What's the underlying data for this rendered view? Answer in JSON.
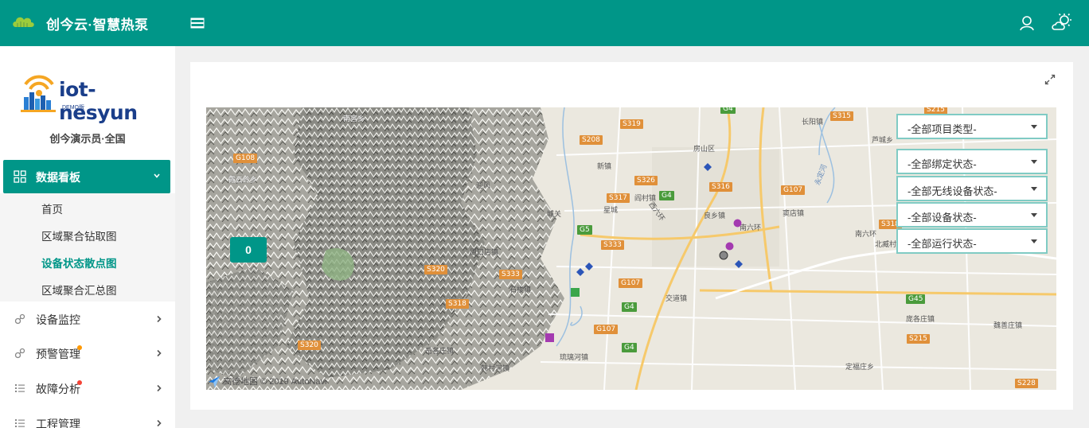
{
  "header": {
    "app_title": "创今云·智慧热泵",
    "icons": [
      "cloud-logo-icon",
      "hamburger-menu-icon",
      "user-icon",
      "weather-icon"
    ]
  },
  "sidebar": {
    "brand_name": "iot-nesyun",
    "brand_sub": "DEMO版",
    "account": "创今演示员·全国",
    "active_group": {
      "label": "数据看板",
      "icon": "grid-icon"
    },
    "sub_items": [
      {
        "label": "首页"
      },
      {
        "label": "区域聚合钻取图"
      },
      {
        "label": "设备状态散点图",
        "current": true
      },
      {
        "label": "区域聚合汇总图"
      }
    ],
    "groups": [
      {
        "label": "设备监控",
        "icon": "gear-link-icon"
      },
      {
        "label": "预警管理",
        "icon": "gear-link-icon",
        "dot_color": "#ff9800"
      },
      {
        "label": "故障分析",
        "icon": "list-icon",
        "dot_color": "#f44336"
      },
      {
        "label": "工程管理",
        "icon": "list-icon"
      }
    ]
  },
  "map": {
    "cluster_button": "0",
    "attribution": "高德地图 © 2019 AutoNavi",
    "filters": [
      {
        "label": "-全部项目类型-"
      },
      {
        "label": "-全部绑定状态-"
      },
      {
        "label": "-全部无线设备状态-"
      },
      {
        "label": "-全部设备状态-"
      },
      {
        "label": "-全部运行状态-"
      }
    ],
    "road_labels": [
      "G4",
      "S215",
      "S315",
      "S319",
      "S208",
      "G108",
      "S326",
      "S317",
      "G4",
      "S316",
      "G107",
      "S318",
      "G5",
      "S333",
      "S320",
      "S333",
      "G107",
      "S318",
      "G4",
      "G107",
      "S320",
      "G4",
      "G45",
      "S215",
      "S228"
    ],
    "places": [
      "南窖乡",
      "长阳镇",
      "芦城乡",
      "房山区",
      "新镇",
      "霞云岭乡",
      "迎风",
      "城关",
      "星城",
      "阎村镇",
      "良乡镇",
      "南六环",
      "窦店镇",
      "周口店镇",
      "西六环",
      "石楼镇",
      "琉璃河镇",
      "交道镇",
      "岳各庄镇",
      "韩村河镇",
      "庞各庄镇",
      "魏善庄镇",
      "定福庄乡",
      "南六环",
      "北臧村镇",
      "永定河"
    ],
    "marker_colors": {
      "blue": "#2b55b8",
      "purple": "#a43ab0",
      "green": "#3aa64a",
      "gray": "#888888"
    }
  }
}
